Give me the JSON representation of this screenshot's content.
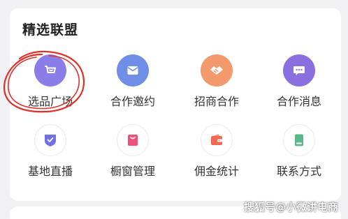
{
  "section": {
    "title": "精选联盟"
  },
  "items": [
    {
      "label": "选品广场",
      "icon": "shopping-cart-icon",
      "color": "#8a7de8"
    },
    {
      "label": "合作邀约",
      "icon": "envelope-icon",
      "color": "#6f8fe6"
    },
    {
      "label": "招商合作",
      "icon": "handshake-icon",
      "color": "#f29a6b"
    },
    {
      "label": "合作消息",
      "icon": "chat-bubble-icon",
      "color": "#8a6fe0"
    },
    {
      "label": "基地直播",
      "icon": "shield-check-icon",
      "color": "#6f6fe6"
    },
    {
      "label": "橱窗管理",
      "icon": "shopping-bag-icon",
      "color": "#f0507a"
    },
    {
      "label": "佣金统计",
      "icon": "wallet-icon",
      "color": "#f06a55"
    },
    {
      "label": "联系方式",
      "icon": "tablet-icon",
      "color": "#5cb88a"
    }
  ],
  "watermark": {
    "text": "搜狐号@小微讲电商"
  },
  "colors": {
    "annotation": "#e0302a"
  }
}
